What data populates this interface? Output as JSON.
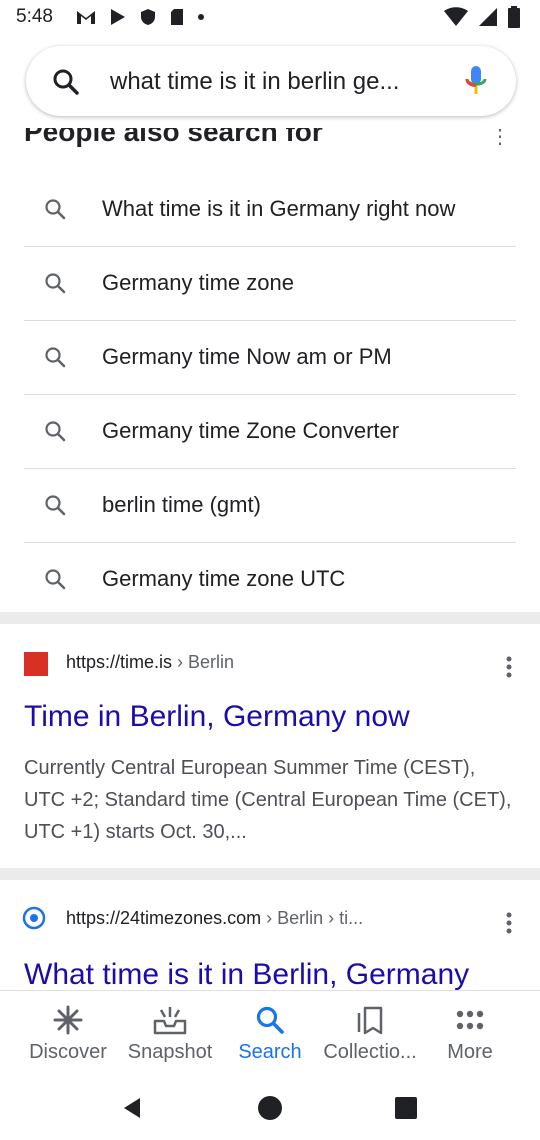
{
  "status_bar": {
    "time": "5:48"
  },
  "search": {
    "query": "what time is it in berlin ge..."
  },
  "people_also_search": {
    "title": "People also search for",
    "items": [
      "What time is it in Germany right now",
      "Germany time zone",
      "Germany time Now am or PM",
      "Germany time Zone Converter",
      "berlin time (gmt)",
      "Germany time zone UTC"
    ]
  },
  "results": [
    {
      "url": "https://time.is",
      "crumb": " › Berlin",
      "title": "Time in Berlin, Germany now",
      "snippet": "Currently Central European Summer Time (CEST), UTC +2; Standard time (Central European Time (CET), UTC +1) starts Oct. 30,..."
    },
    {
      "url": "https://24timezones.com",
      "crumb": " › Berlin › ti...",
      "title": "What time is it in Berlin, Germany"
    }
  ],
  "bottom_nav": {
    "items": [
      "Discover",
      "Snapshot",
      "Search",
      "Collectio...",
      "More"
    ],
    "active": "Search"
  },
  "colors": {
    "link": "#1a0dab",
    "accent": "#1a73e8",
    "favicon_time": "#d93025"
  }
}
